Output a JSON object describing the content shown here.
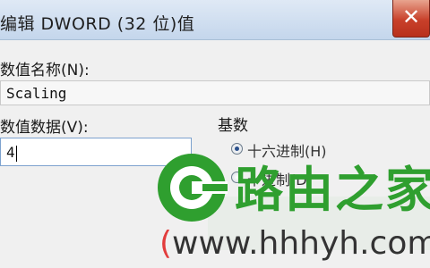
{
  "window": {
    "title": "编辑 DWORD (32 位)值",
    "close_glyph": "✕"
  },
  "value_name": {
    "label": "数值名称(N):",
    "value": "Scaling"
  },
  "value_data": {
    "label": "数值数据(V):",
    "value": "4"
  },
  "base": {
    "title": "基数",
    "options": [
      {
        "label": "十六进制(H)",
        "selected": true
      },
      {
        "label": "十进制(D)",
        "selected": false
      }
    ]
  },
  "watermark": {
    "brand_text": "路由之家",
    "url_open": "(",
    "url_text": "www.hhhyh.com",
    "logo_icon": "router-home-logo",
    "brand_color": "#2f9f2f"
  }
}
